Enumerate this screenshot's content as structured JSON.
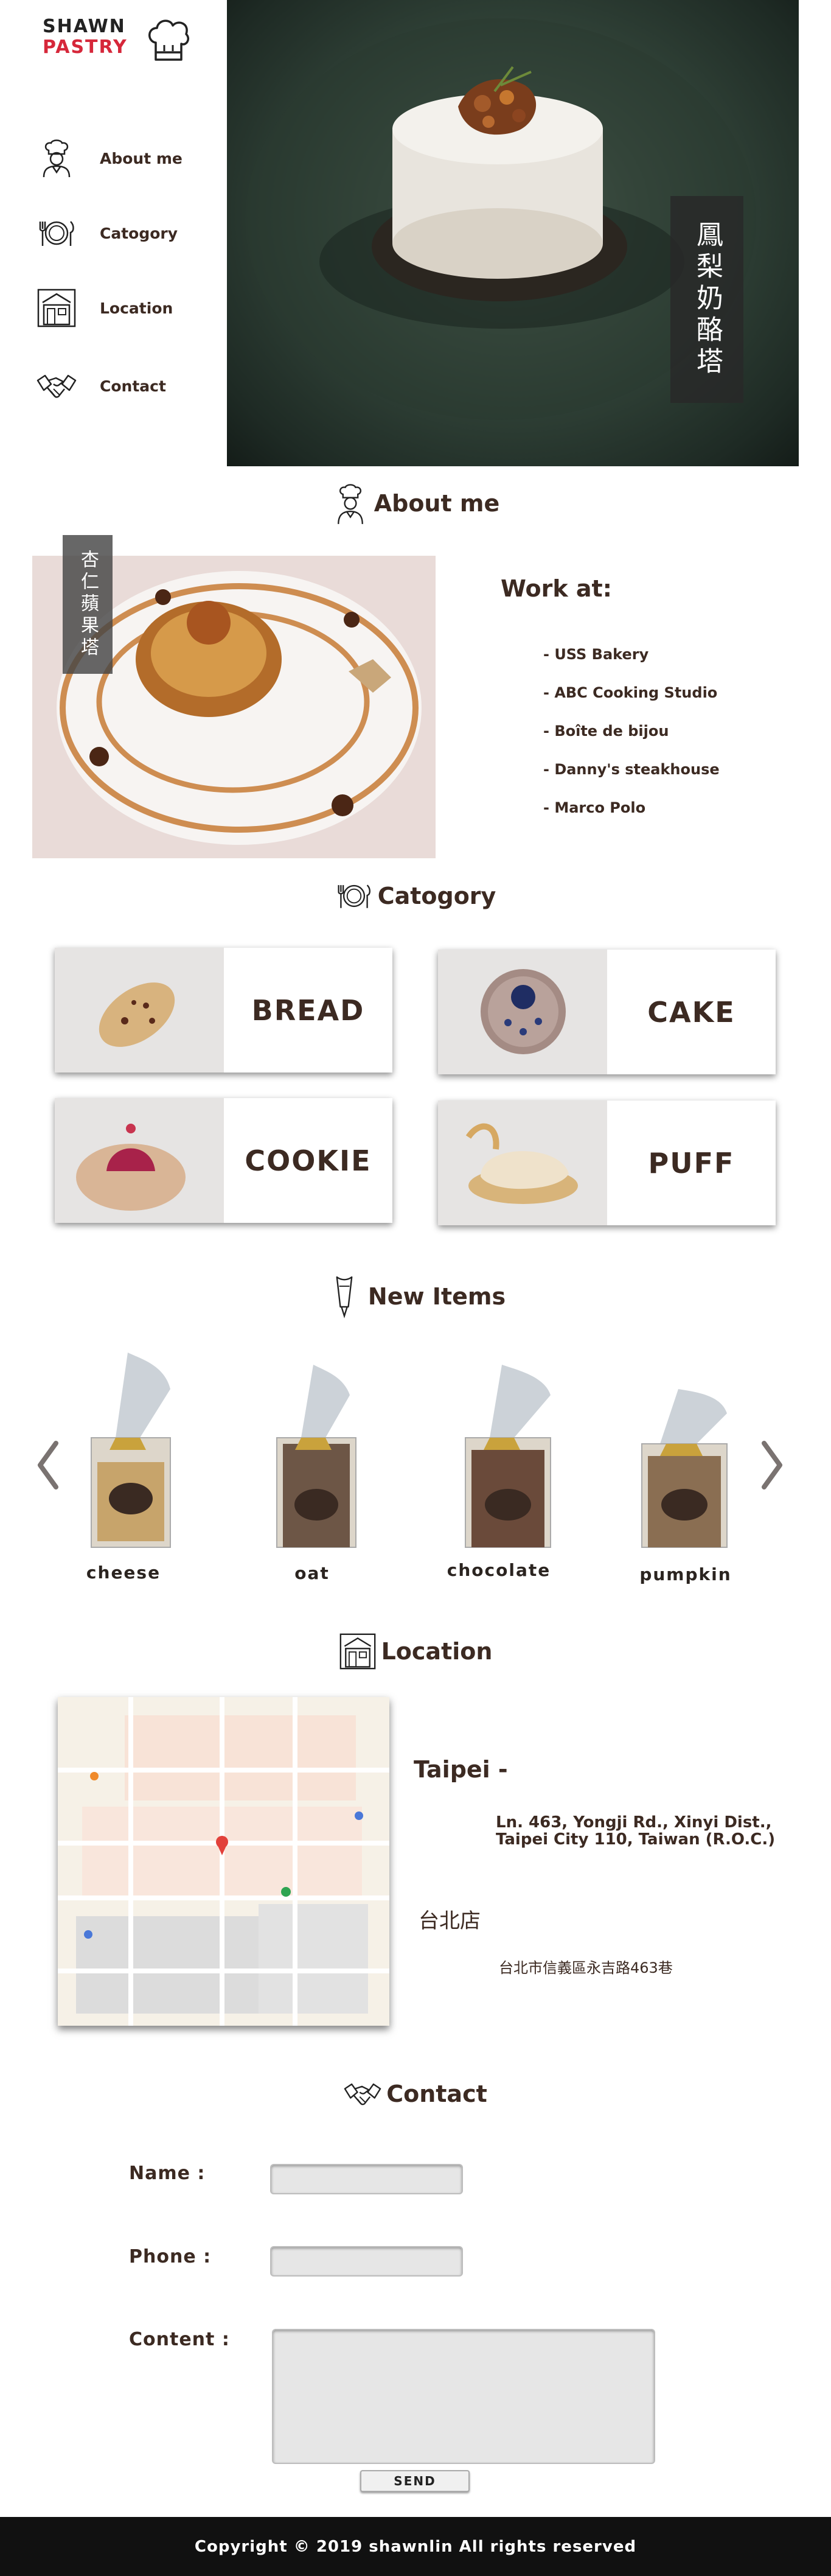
{
  "brand": {
    "line1": "SHAWN",
    "line2": "PASTRY",
    "accent": "#d6273a",
    "text_color": "#3c2a22"
  },
  "nav": [
    {
      "label": "About me",
      "icon": "chef-icon"
    },
    {
      "label": "Catogory",
      "icon": "plate-fork-knife-icon"
    },
    {
      "label": "Location",
      "icon": "storefront-icon"
    },
    {
      "label": "Contact",
      "icon": "handshake-icon"
    }
  ],
  "hero": {
    "label": "鳳梨奶酪塔"
  },
  "about": {
    "title": "About me",
    "image_label": "杏仁蘋果塔",
    "work_title": "Work at:",
    "work_list": [
      "- USS Bakery",
      "- ABC Cooking Studio",
      "- Boîte de bijou",
      "- Danny's steakhouse",
      "- Marco Polo"
    ]
  },
  "category": {
    "title": "Catogory",
    "items": [
      "BREAD",
      "CAKE",
      "COOKIE",
      "PUFF"
    ]
  },
  "new_items": {
    "title": "New Items",
    "items": [
      "cheese",
      "oat",
      "chocolate",
      "pumpkin"
    ],
    "prev_icon": "chevron-left-icon",
    "next_icon": "chevron-right-icon"
  },
  "location": {
    "title": "Location",
    "city": "Taipei -",
    "address_line1": "Ln. 463, Yongji Rd., Xinyi Dist.,",
    "address_line2": "Taipei City 110, Taiwan (R.O.C.)",
    "store": "台北店",
    "address_zh": "台北市信義區永吉路463巷"
  },
  "contact": {
    "title": "Contact",
    "name_label": "Name :",
    "phone_label": "Phone :",
    "content_label": "Content :",
    "send_label": "SEND"
  },
  "footer": {
    "text": "Copyright © 2019 shawnlin All rights reserved"
  }
}
